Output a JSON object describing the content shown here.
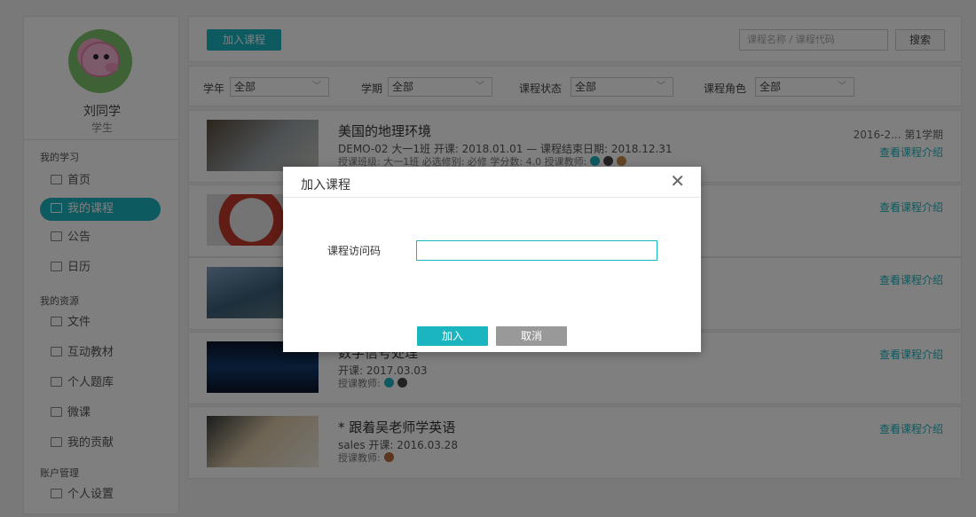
{
  "user": {
    "name": "刘同学",
    "role": "学生"
  },
  "sidebar": {
    "sections": [
      {
        "title": "我的学习"
      },
      {
        "title": "我的资源"
      },
      {
        "title": "账户管理"
      }
    ],
    "items": [
      {
        "label": "首页",
        "icon": "home-icon"
      },
      {
        "label": "我的课程",
        "icon": "course-icon"
      },
      {
        "label": "公告",
        "icon": "announcement-icon"
      },
      {
        "label": "日历",
        "icon": "calendar-icon"
      },
      {
        "label": "文件",
        "icon": "file-icon"
      },
      {
        "label": "互动教材",
        "icon": "textbook-icon"
      },
      {
        "label": "个人题库",
        "icon": "question-bank-icon"
      },
      {
        "label": "微课",
        "icon": "micro-course-icon"
      },
      {
        "label": "我的贡献",
        "icon": "contribution-icon"
      },
      {
        "label": "个人设置",
        "icon": "settings-icon"
      }
    ]
  },
  "toolbar": {
    "add_course": "加入课程",
    "search_placeholder": "课程名称 / 课程代码",
    "search": "搜索"
  },
  "filters": [
    {
      "label": "学年",
      "value": "全部"
    },
    {
      "label": "学期",
      "value": "全部"
    },
    {
      "label": "课程状态",
      "value": "全部"
    },
    {
      "label": "课程角色",
      "value": "全部"
    }
  ],
  "courses": [
    {
      "title": "美国的地理环境",
      "line1": "DEMO-02   大一1班   开课: 2018.01.01  —  课程结束日期: 2018.12.31",
      "line2": "授课班级: 大一1班      必选修别: 必修      学分数: 4.0      授课教师:",
      "term": "2016-2...   第1学期",
      "link": "查看课程介绍"
    },
    {
      "title": "",
      "line1": "",
      "line2": "",
      "term": "",
      "link": "查看课程介绍"
    },
    {
      "title": "",
      "line1": "",
      "line2": "",
      "term": "",
      "link": "查看课程介绍"
    },
    {
      "title": "数字信号处理",
      "line1": "开课: 2017.03.03",
      "line2": "授课教师:",
      "term": "",
      "link": "查看课程介绍"
    },
    {
      "title": "* 跟着吴老师学英语",
      "line1": "sales   开课: 2016.03.28",
      "line2": "授课教师:",
      "term": "",
      "link": "查看课程介绍"
    }
  ],
  "modal": {
    "title": "加入课程",
    "close": "✕",
    "field_label": "课程访问码",
    "field_value": "",
    "join": "加入",
    "cancel": "取消"
  },
  "colors": {
    "accent": "#1bb5c0",
    "cancel": "#999999"
  }
}
